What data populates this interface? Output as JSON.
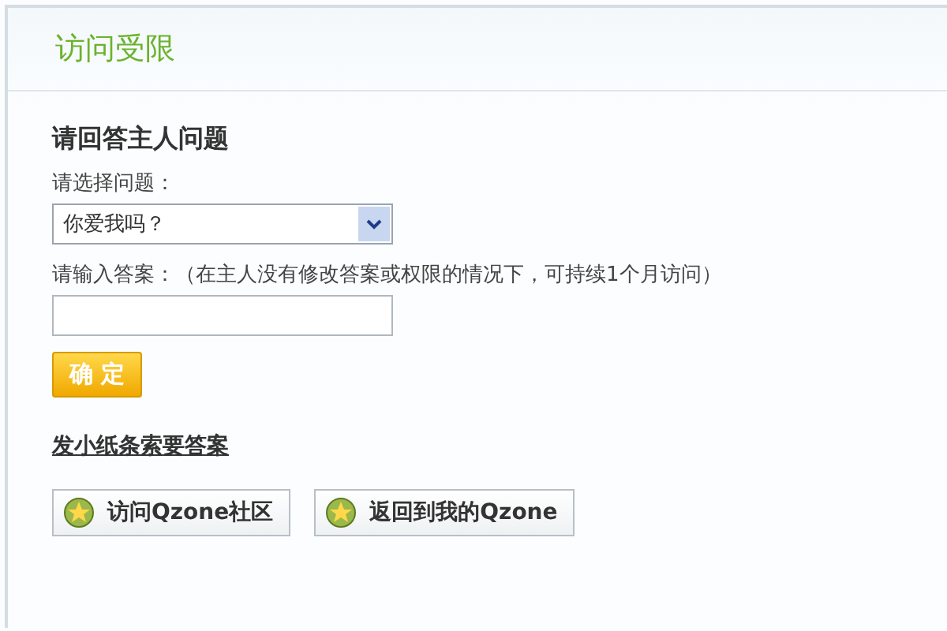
{
  "header": {
    "title": "访问受限"
  },
  "section": {
    "heading": "请回答主人问题",
    "question_label": "请选择问题：",
    "question_value": "你爱我吗？",
    "answer_label": "请输入答案：（在主人没有修改答案或权限的情况下，可持续1个月访问）",
    "submit": "确 定"
  },
  "note_link": "发小纸条索要答案",
  "buttons": [
    {
      "label": "访问Qzone社区"
    },
    {
      "label": "返回到我的Qzone"
    }
  ]
}
